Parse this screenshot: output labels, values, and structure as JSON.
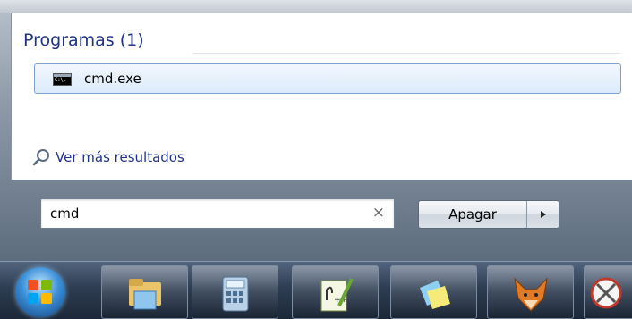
{
  "start_menu": {
    "group_header": "Programas (1)",
    "result_item": {
      "label": "cmd.exe",
      "icon": "command-prompt-icon",
      "icon_text": "C:\\."
    },
    "see_more": {
      "label": "Ver más resultados",
      "icon": "search-icon"
    },
    "search": {
      "value": "cmd",
      "clear_glyph": "×"
    },
    "shutdown": {
      "label": "Apagar",
      "arrow_glyph": "▸"
    }
  },
  "taskbar": {
    "start_button": "windows-start-orb",
    "pinned": [
      {
        "name": "windows-explorer-icon"
      },
      {
        "name": "calculator-icon"
      },
      {
        "name": "notepad-plus-plus-icon"
      },
      {
        "name": "sticky-notes-icon"
      },
      {
        "name": "fox-app-icon"
      },
      {
        "name": "snipping-tool-icon"
      }
    ]
  },
  "colors": {
    "accent_text": "#1e3287",
    "selection_border": "#7da2ce",
    "taskbar": "#2e3d52"
  }
}
